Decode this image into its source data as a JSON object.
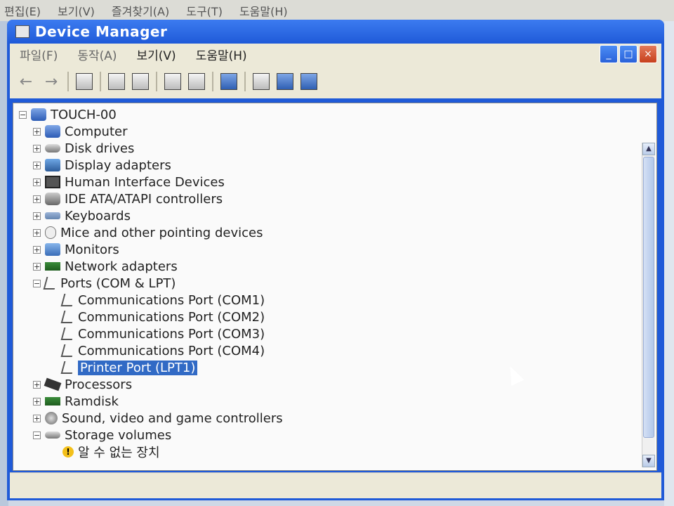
{
  "background_menu": [
    "편집(E)",
    "보기(V)",
    "즐겨찾기(A)",
    "도구(T)",
    "도움말(H)"
  ],
  "window": {
    "title": "Device Manager",
    "menu": [
      {
        "label": "파일(F)",
        "dim": true
      },
      {
        "label": "동작(A)",
        "dim": true
      },
      {
        "label": "보기(V)",
        "dim": false
      },
      {
        "label": "도움말(H)",
        "dim": false
      }
    ]
  },
  "tree": {
    "root": "TOUCH-00",
    "items": [
      {
        "label": "Computer",
        "icon": "comp",
        "exp": "+"
      },
      {
        "label": "Disk drives",
        "icon": "disk",
        "exp": "+"
      },
      {
        "label": "Display adapters",
        "icon": "disp",
        "exp": "+"
      },
      {
        "label": "Human Interface Devices",
        "icon": "hid",
        "exp": "+"
      },
      {
        "label": "IDE ATA/ATAPI controllers",
        "icon": "ide",
        "exp": "+"
      },
      {
        "label": "Keyboards",
        "icon": "kbd",
        "exp": "+"
      },
      {
        "label": "Mice and other pointing devices",
        "icon": "mouse",
        "exp": "+"
      },
      {
        "label": "Monitors",
        "icon": "mon",
        "exp": "+"
      },
      {
        "label": "Network adapters",
        "icon": "net",
        "exp": "+"
      },
      {
        "label": "Ports (COM & LPT)",
        "icon": "port",
        "exp": "-"
      },
      {
        "label": "Communications Port (COM1)",
        "icon": "port",
        "child": true
      },
      {
        "label": "Communications Port (COM2)",
        "icon": "port",
        "child": true
      },
      {
        "label": "Communications Port (COM3)",
        "icon": "port",
        "child": true
      },
      {
        "label": "Communications Port (COM4)",
        "icon": "port",
        "child": true
      },
      {
        "label": "Printer Port (LPT1)",
        "icon": "port",
        "child": true,
        "selected": true
      },
      {
        "label": "Processors",
        "icon": "cpu",
        "exp": "+"
      },
      {
        "label": "Ramdisk",
        "icon": "ram",
        "exp": "+"
      },
      {
        "label": "Sound, video and game controllers",
        "icon": "snd",
        "exp": "+"
      },
      {
        "label": "Storage volumes",
        "icon": "stor",
        "exp": "-"
      },
      {
        "label": "알 수 없는 장치",
        "icon": "warn",
        "child": true
      }
    ]
  }
}
